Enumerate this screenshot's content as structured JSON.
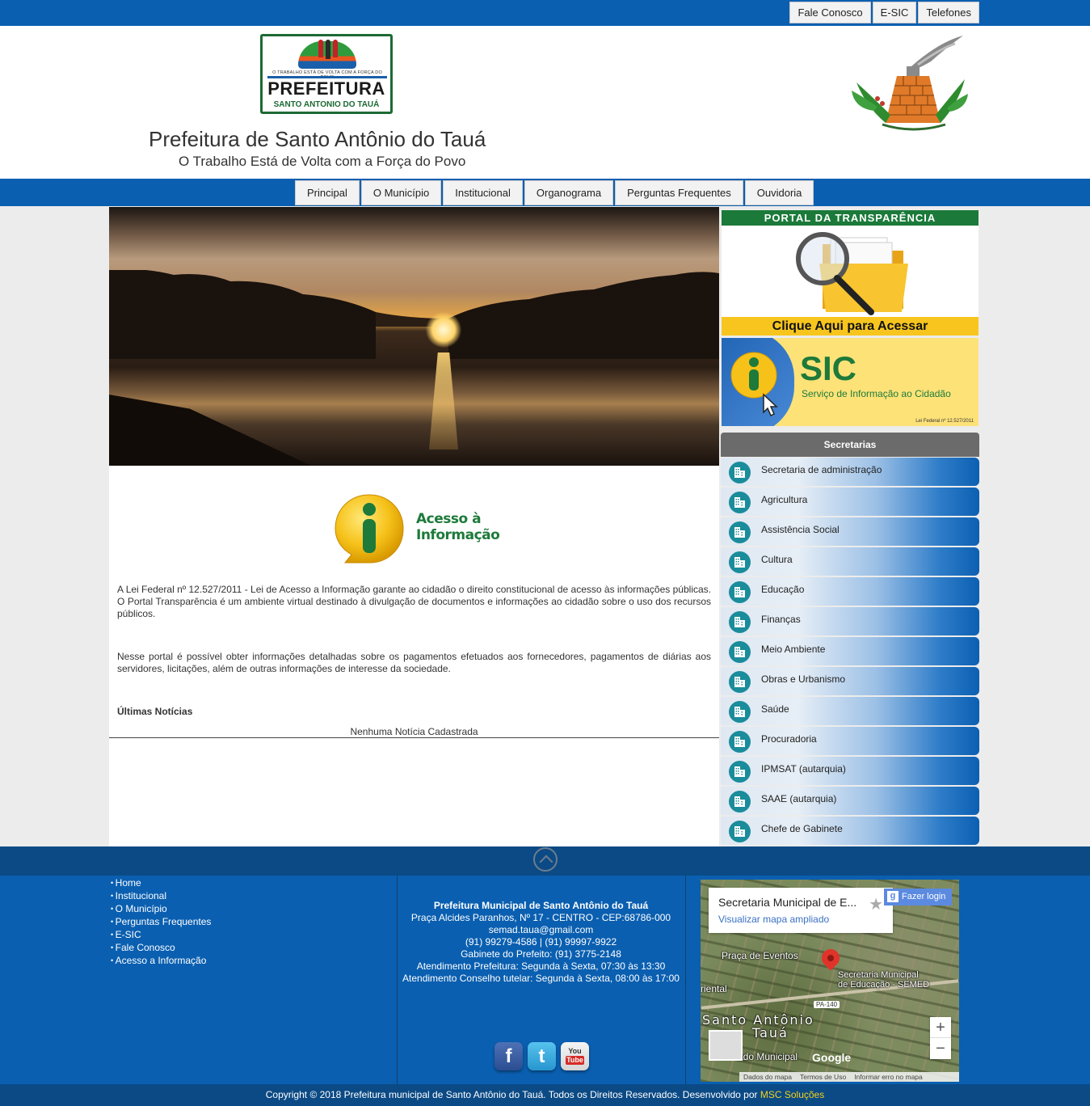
{
  "topbar": {
    "links": [
      "Fale Conosco",
      "E-SIC",
      "Telefones"
    ]
  },
  "header": {
    "logo": {
      "slogan": "O TRABALHO ESTÁ DE VOLTA COM A FORÇA DO POVO",
      "word": "PREFEITURA",
      "sub": "SANTO ANTONIO DO TAUÁ"
    },
    "title": "Prefeitura de Santo Antônio do Tauá",
    "slogan": "O Trabalho Está de Volta com a Força do Povo"
  },
  "nav": {
    "items": [
      "Principal",
      "O Município",
      "Institucional",
      "Organograma",
      "Perguntas Frequentes",
      "Ouvidoria"
    ]
  },
  "main": {
    "access_info": {
      "line1": "Acesso à",
      "line2": "Informação"
    },
    "paragraph1": "A Lei Federal nº 12.527/2011 - Lei de Acesso a Informação garante ao cidadão o direito constitucional de acesso às informações públicas. O Portal Transparência é um ambiente virtual destinado à divulgação de documentos e informações ao cidadão sobre o uso dos recursos públicos.",
    "paragraph2": "Nesse portal é possível obter informações detalhadas sobre os pagamentos efetuados aos fornecedores, pagamentos de diárias aos servidores, licitações, além de outras informações de interesse da sociedade.",
    "news_title": "Últimas Notícias",
    "news_empty": "Nenhuma Notícia Cadastrada"
  },
  "sidebar": {
    "transparency": {
      "head": "PORTAL  DA TRANSPARÊNCIA",
      "foot": "Clique Aqui para Acessar"
    },
    "sic": {
      "title": "SIC",
      "desc": "Serviço de Informação ao Cidadão",
      "law": "Lei Federal nº 12.527/2011"
    },
    "secretarias_title": "Secretarias",
    "secretarias": [
      "Secretaria de administração",
      "Agricultura",
      "Assistência Social",
      "Cultura",
      "Educação",
      "Finanças",
      "Meio Ambiente",
      "Obras e Urbanismo",
      "Saúde",
      "Procuradoria",
      "IPMSAT (autarquia)",
      "SAAE (autarquia)",
      "Chefe de Gabinete"
    ],
    "secretaria_icon": "building-icon"
  },
  "footer": {
    "links": [
      "Home",
      "Institucional",
      "O Município",
      "Perguntas Frequentes",
      "E-SIC",
      "Fale Conosco",
      "Acesso a Informação"
    ],
    "info": {
      "name": "Prefeitura Municipal de Santo Antônio do Tauá",
      "address": "Praça Alcides Paranhos, Nº 17 - CENTRO - CEP:68786-000",
      "email": "semad.taua@gmail.com",
      "phones": "(91) 99279-4586 | (91) 99997-9922",
      "gabinete": "Gabinete do Prefeito: (91) 3775-2148",
      "hours": "Atendimento Prefeitura: Segunda à Sexta, 07:30 às 13:30",
      "conselho": "Atendimento Conselho tutelar: Segunda à Sexta, 08:00 às 17:00"
    },
    "social": {
      "facebook": "f",
      "twitter": "t",
      "youtube_you": "You",
      "youtube_tube": "Tube"
    },
    "map": {
      "place": "Secretaria Municipal de E...",
      "link": "Visualizar mapa ampliado",
      "login": "Fazer login",
      "label_eventos": "Praça de Eventos",
      "label_sec": "Secretaria Municipal",
      "label_sec2": "de Educação - SEMED",
      "label_oriental": "riental",
      "label_town1": "Santo Antônio",
      "label_town2": "Tauá",
      "label_municipal": "ado Municipal",
      "road": "PA-140",
      "google": "Google",
      "attrib": [
        "Dados do mapa",
        "Termos de Uso",
        "Informar erro no mapa"
      ]
    }
  },
  "copyright": {
    "text": "Copyright © 2018 Prefeitura municipal de Santo Antônio do Tauá. Todos os Direitos Reservados. Desenvolvido por",
    "dev": "MSC Soluções"
  }
}
